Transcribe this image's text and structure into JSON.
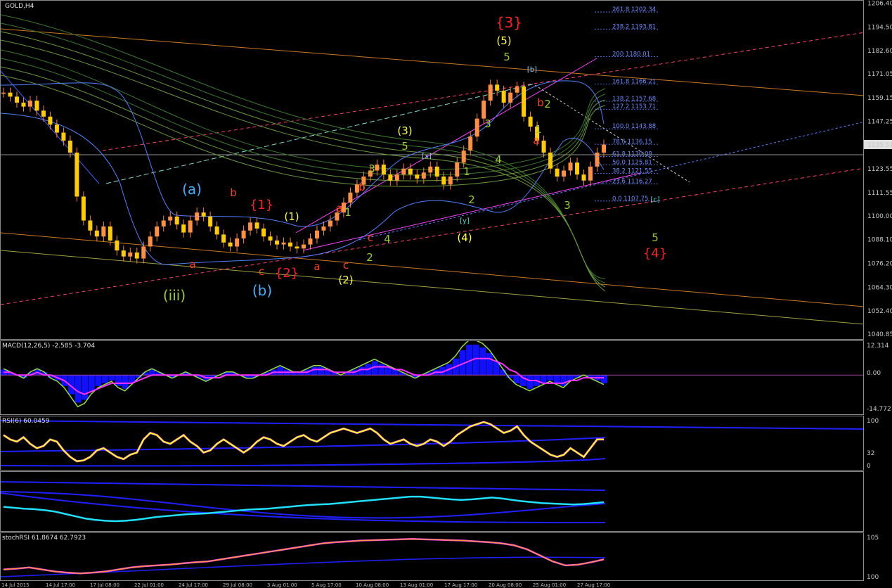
{
  "window": {
    "symbol_label": "GOLD,H4"
  },
  "chart_data": [
    {
      "type": "line",
      "title": "GOLD,H4",
      "price_ticks": [
        "1206.40",
        "1194.50",
        "1182.60",
        "1171.05",
        "1159.15",
        "1147.25",
        "1135.51",
        "1123.55",
        "1111.55",
        "1100.00",
        "1088.10",
        "1076.20",
        "1064.30",
        "1052.40",
        "1040.85"
      ],
      "current_price": "1135.51",
      "ylim": [
        1038,
        1208
      ],
      "close": [
        1162,
        1160,
        1157,
        1155,
        1158,
        1153,
        1150,
        1146,
        1142,
        1138,
        1132,
        1110,
        1098,
        1093,
        1090,
        1095,
        1088,
        1083,
        1080,
        1082,
        1079,
        1085,
        1090,
        1095,
        1098,
        1100,
        1096,
        1092,
        1098,
        1102,
        1100,
        1095,
        1091,
        1087,
        1085,
        1089,
        1093,
        1097,
        1094,
        1090,
        1088,
        1086,
        1087,
        1085,
        1084,
        1086,
        1089,
        1093,
        1095,
        1098,
        1102,
        1107,
        1112,
        1116,
        1120,
        1123,
        1126,
        1121,
        1118,
        1121,
        1124,
        1121,
        1119,
        1122,
        1125,
        1120,
        1116,
        1120,
        1127,
        1133,
        1140,
        1149,
        1158,
        1166,
        1163,
        1157,
        1162,
        1165,
        1150,
        1145,
        1138,
        1132,
        1124,
        1120,
        1123,
        1127,
        1121,
        1118,
        1125,
        1132,
        1136
      ],
      "fib_levels": [
        {
          "pct": "261.8",
          "price": "1202.34"
        },
        {
          "pct": "238.2",
          "price": "1193.81"
        },
        {
          "pct": "200",
          "price": "1180.01"
        },
        {
          "pct": "161.8",
          "price": "1166.21"
        },
        {
          "pct": "138.2",
          "price": "1157.68"
        },
        {
          "pct": "127.2",
          "price": "1153.71"
        },
        {
          "pct": "100.0",
          "price": "1143.88"
        },
        {
          "pct": "78.6",
          "price": "1136.15"
        },
        {
          "pct": "61.8",
          "price": "1130.08"
        },
        {
          "pct": "50.0",
          "price": "1125.81"
        },
        {
          "pct": "38.2",
          "price": "1121.55"
        },
        {
          "pct": "23.6",
          "price": "1116.27"
        },
        {
          "pct": "0.0",
          "price": "1107.75"
        }
      ],
      "wave_labels": [
        {
          "text": "{3}",
          "color": "#ff2020"
        },
        {
          "text": "(5)",
          "color": "#ffff40"
        },
        {
          "text": "5",
          "color": "#9acd32"
        },
        {
          "text": "[b]",
          "color": "#87cefa"
        },
        {
          "text": "2",
          "color": "#9acd32"
        },
        {
          "text": "b",
          "color": "#ff4020"
        },
        {
          "text": "1",
          "color": "#9acd32"
        },
        {
          "text": "a",
          "color": "#ff4020"
        },
        {
          "text": "3",
          "color": "#9acd32"
        },
        {
          "text": "(3)",
          "color": "#ffff40"
        },
        {
          "text": "5",
          "color": "#9acd32"
        },
        {
          "text": "[x]",
          "color": "#87cefa"
        },
        {
          "text": "1",
          "color": "#9acd32"
        },
        {
          "text": "2",
          "color": "#9acd32"
        },
        {
          "text": "3",
          "color": "#9acd32"
        },
        {
          "text": "4",
          "color": "#9acd32"
        },
        {
          "text": "(4)",
          "color": "#ffff40"
        },
        {
          "text": "[y]",
          "color": "#40e0d0"
        },
        {
          "text": "3",
          "color": "#9acd32"
        },
        {
          "text": "b",
          "color": "#ff4020"
        },
        {
          "text": "1",
          "color": "#9acd32"
        },
        {
          "text": "a",
          "color": "#ff4020"
        },
        {
          "text": "c",
          "color": "#ff4020"
        },
        {
          "text": "2",
          "color": "#9acd32"
        },
        {
          "text": "4",
          "color": "#9acd32"
        },
        {
          "text": "(a)",
          "color": "#40b0ff"
        },
        {
          "text": "b",
          "color": "#ff4020"
        },
        {
          "text": "{1}",
          "color": "#ff2020"
        },
        {
          "text": "(1)",
          "color": "#ffff40"
        },
        {
          "text": "a",
          "color": "#ff4020"
        },
        {
          "text": "c",
          "color": "#ff4020"
        },
        {
          "text": "{2}",
          "color": "#ff2020"
        },
        {
          "text": "a",
          "color": "#ff4020"
        },
        {
          "text": "c",
          "color": "#ff4020"
        },
        {
          "text": "(2)",
          "color": "#ffff40"
        },
        {
          "text": "(iii)",
          "color": "#9acd32"
        },
        {
          "text": "(b)",
          "color": "#40b0ff"
        },
        {
          "text": "[c]",
          "color": "#40e0d0"
        },
        {
          "text": "5",
          "color": "#9acd32"
        },
        {
          "text": "{4}",
          "color": "#ff2020"
        }
      ]
    },
    {
      "type": "area",
      "title": "MACD(12,26,5) -2.585 -3.704",
      "ticks": [
        "12.314",
        "0.00",
        "-14.772"
      ],
      "ylim": [
        -14.772,
        12.314
      ],
      "histogram": [
        2,
        1,
        0,
        -1,
        1,
        2,
        1,
        -1,
        -2,
        -4,
        -7,
        -10,
        -9,
        -6,
        -4,
        -3,
        -2,
        -4,
        -5,
        -3,
        -1,
        1,
        2,
        1,
        0,
        -1,
        0,
        1,
        0,
        -1,
        -2,
        -1,
        0,
        1,
        1,
        0,
        -1,
        -1,
        0,
        1,
        2,
        3,
        2,
        1,
        1,
        2,
        3,
        3,
        2,
        1,
        0,
        1,
        2,
        3,
        4,
        5,
        4,
        3,
        2,
        1,
        0,
        -1,
        0,
        1,
        2,
        3,
        4,
        6,
        9,
        11,
        11,
        10,
        8,
        5,
        2,
        -1,
        -3,
        -4,
        -5,
        -4,
        -3,
        -2,
        -3,
        -4,
        -2,
        -1,
        0,
        -1,
        -2,
        -3
      ],
      "signal": [
        1,
        1,
        0,
        0,
        0,
        1,
        0,
        0,
        -1,
        -2,
        -4,
        -6,
        -7,
        -6,
        -5,
        -4,
        -3,
        -3,
        -3,
        -3,
        -2,
        -1,
        0,
        0,
        0,
        0,
        0,
        0,
        0,
        0,
        -1,
        -1,
        -1,
        0,
        0,
        0,
        0,
        0,
        0,
        0,
        1,
        1,
        1,
        1,
        1,
        1,
        2,
        2,
        2,
        1,
        1,
        1,
        1,
        2,
        2,
        3,
        3,
        3,
        2,
        2,
        1,
        0,
        0,
        0,
        1,
        1,
        2,
        3,
        4,
        5,
        6,
        6,
        6,
        5,
        4,
        2,
        1,
        -1,
        -2,
        -2,
        -3,
        -3,
        -3,
        -3,
        -2,
        -2,
        -1,
        -1,
        -1,
        -1
      ]
    },
    {
      "type": "line",
      "title": "RSI(6) 60.0459",
      "ticks": [
        "100",
        "32",
        "0"
      ],
      "ylim": [
        0,
        100
      ],
      "values": [
        70,
        60,
        55,
        65,
        50,
        40,
        45,
        60,
        55,
        35,
        20,
        10,
        12,
        20,
        35,
        40,
        30,
        20,
        15,
        25,
        30,
        60,
        75,
        70,
        55,
        50,
        60,
        70,
        55,
        45,
        30,
        35,
        50,
        60,
        50,
        40,
        30,
        40,
        55,
        65,
        60,
        50,
        45,
        55,
        65,
        70,
        60,
        55,
        65,
        75,
        80,
        85,
        80,
        75,
        80,
        85,
        75,
        60,
        50,
        55,
        60,
        50,
        45,
        50,
        60,
        55,
        45,
        55,
        70,
        80,
        90,
        95,
        100,
        95,
        85,
        75,
        80,
        90,
        70,
        55,
        45,
        35,
        25,
        20,
        25,
        40,
        30,
        20,
        40,
        60,
        60
      ]
    },
    {
      "type": "line",
      "title": "",
      "values": [
        40,
        38,
        36,
        35,
        33,
        30,
        25,
        20,
        15,
        12,
        10,
        9,
        10,
        12,
        15,
        18,
        20,
        22,
        24,
        25,
        26,
        28,
        30,
        32,
        34,
        35,
        36,
        38,
        40,
        42,
        44,
        45,
        46,
        48,
        50,
        52,
        54,
        56,
        58,
        60,
        62,
        62,
        60,
        58,
        56,
        55,
        56,
        58,
        60,
        58,
        55,
        52,
        50,
        48,
        47,
        46,
        45,
        46,
        48,
        50
      ]
    },
    {
      "type": "line",
      "title": "stochRSI 61.8674 62.7923",
      "ticks": [
        "105",
        "100"
      ],
      "values": [
        20,
        22,
        25,
        20,
        15,
        12,
        10,
        12,
        15,
        20,
        25,
        28,
        30,
        32,
        35,
        38,
        40,
        45,
        50,
        55,
        60,
        65,
        70,
        75,
        80,
        85,
        88,
        90,
        92,
        93,
        94,
        95,
        96,
        95,
        94,
        93,
        92,
        90,
        88,
        85,
        80,
        70,
        55,
        40,
        30,
        32,
        38,
        45
      ]
    }
  ],
  "timebar": {
    "labels": [
      "14 Jul 2015",
      "14 Jul 17:00",
      "17 Jul 08:00",
      "22 Jul 01:00",
      "24 Jul 17:00",
      "29 Jul 08:00",
      "3 Aug 01:00",
      "5 Aug 17:00",
      "10 Aug 08:00",
      "13 Aug 01:00",
      "17 Aug 17:00",
      "20 Aug 08:00",
      "25 Aug 01:00",
      "27 Aug 17:00"
    ]
  }
}
